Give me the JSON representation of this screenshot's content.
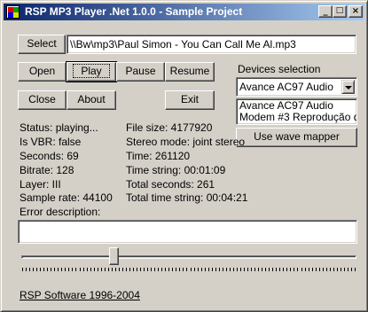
{
  "window": {
    "title": "RSP MP3 Player .Net 1.0.0 - Sample Project",
    "minimize_glyph": "_",
    "maximize_glyph": "□",
    "close_glyph": "×"
  },
  "file": {
    "select_label": "Select",
    "path": "\\\\Bw\\mp3\\Paul Simon - You Can Call Me Al.mp3"
  },
  "controls": {
    "open": "Open",
    "play": "Play",
    "pause": "Pause",
    "resume": "Resume",
    "close": "Close",
    "about": "About",
    "exit": "Exit"
  },
  "devices": {
    "heading": "Devices selection",
    "selected": "Avance AC97 Audio",
    "list": [
      "Avance AC97 Audio",
      "Modem #3 Reprodução de"
    ],
    "wave_mapper_label": "Use wave mapper"
  },
  "status_left": [
    "Status: playing...",
    "Is VBR: false",
    "Seconds: 69",
    "Bitrate: 128",
    "Layer: III",
    "Sample rate: 44100"
  ],
  "status_right": [
    "File size: 4177920",
    "Stereo mode: joint stereo",
    "Time: 261120",
    "Time string: 00:01:09",
    "Total seconds: 261",
    "Total time string: 00:04:21"
  ],
  "error": {
    "label": "Error description:",
    "value": ""
  },
  "seek": {
    "position": 0.27
  },
  "footer": {
    "link": "RSP Software 1996-2004"
  }
}
